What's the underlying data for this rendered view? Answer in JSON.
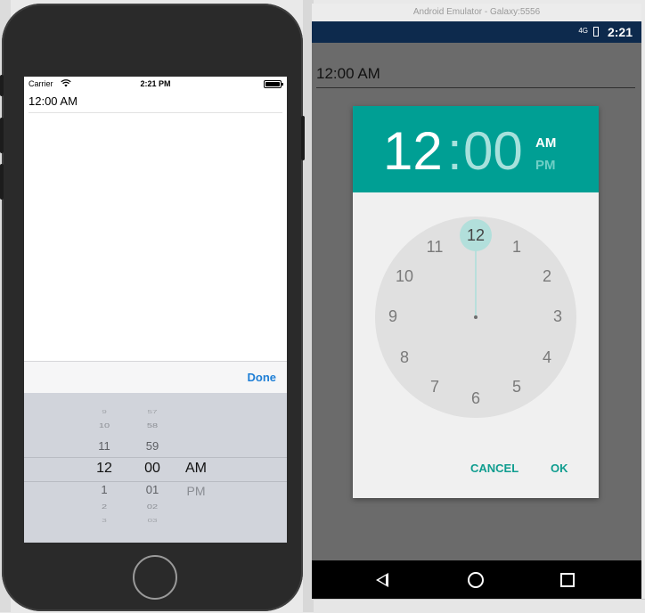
{
  "ios": {
    "status": {
      "carrier": "Carrier",
      "time": "2:21 PM"
    },
    "field_value": "12:00 AM",
    "toolbar": {
      "done_label": "Done"
    },
    "picker": {
      "hours": [
        "9",
        "10",
        "11",
        "12",
        "1",
        "2",
        "3"
      ],
      "minutes": [
        "57",
        "58",
        "59",
        "00",
        "01",
        "02",
        "03"
      ],
      "ampm": [
        "AM",
        "PM"
      ]
    }
  },
  "android": {
    "window_title": "Android Emulator - Galaxy:5556",
    "status": {
      "signal": "4G",
      "time": "2:21"
    },
    "field_value": "12:00 AM",
    "dialog": {
      "hour": "12",
      "colon": ":",
      "minute": "00",
      "am": "AM",
      "pm": "PM",
      "clock_numbers": [
        "12",
        "1",
        "2",
        "3",
        "4",
        "5",
        "6",
        "7",
        "8",
        "9",
        "10",
        "11"
      ],
      "cancel_label": "CANCEL",
      "ok_label": "OK"
    }
  },
  "colors": {
    "android_accent": "#009f94",
    "ios_accent": "#1f7fd6"
  }
}
